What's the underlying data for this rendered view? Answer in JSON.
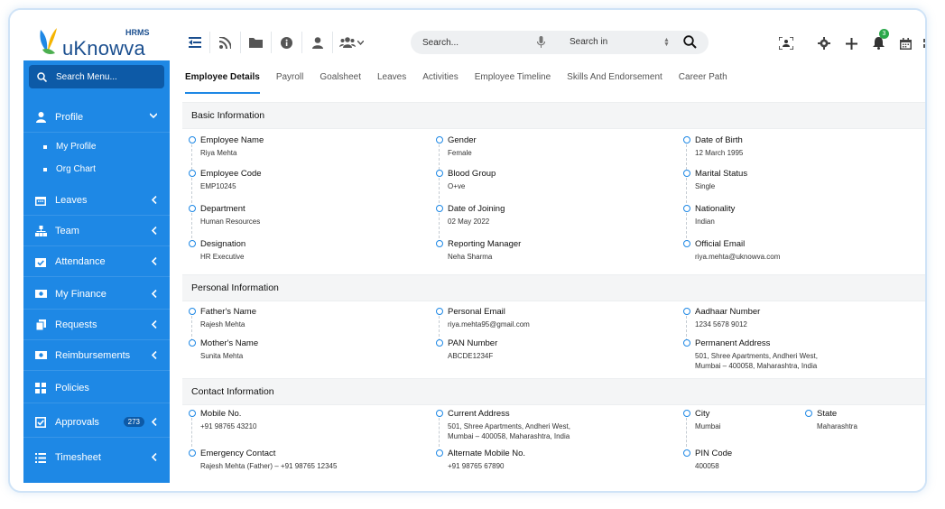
{
  "app": {
    "name": "uKnowva",
    "tag": "HRMS"
  },
  "search": {
    "placeholder": "Search...",
    "scope_label": "Search in"
  },
  "notifications": {
    "count": "3"
  },
  "sidebar": {
    "search_label": "Search Menu...",
    "items": [
      {
        "label": "Profile",
        "icon": "user-icon"
      },
      {
        "label": "Leaves",
        "icon": "calendar-icon"
      },
      {
        "label": "Team",
        "icon": "team-icon"
      },
      {
        "label": "Attendance",
        "icon": "attendance-icon"
      },
      {
        "label": "My Finance",
        "icon": "finance-icon"
      },
      {
        "label": "Requests",
        "icon": "requests-icon"
      },
      {
        "label": "Reimbursements",
        "icon": "reimbursement-icon"
      },
      {
        "label": "Policies",
        "icon": "policies-icon"
      },
      {
        "label": "Approvals",
        "icon": "approvals-icon",
        "count": "273"
      },
      {
        "label": "Timesheet",
        "icon": "timesheet-icon"
      }
    ],
    "profile_sub": [
      "My Profile",
      "Org Chart"
    ]
  },
  "tabs": [
    "Employee Details",
    "Payroll",
    "Goalsheet",
    "Leaves",
    "Activities",
    "Employee Timeline",
    "Skills And Endorsement",
    "Career Path"
  ],
  "sections": {
    "basic": {
      "title": "Basic Information",
      "fields": [
        {
          "label": "Employee Name",
          "value": "Riya Mehta"
        },
        {
          "label": "Gender",
          "value": "Female"
        },
        {
          "label": "Date of Birth",
          "value": "12 March 1995"
        },
        {
          "label": "Employee Code",
          "value": "EMP10245"
        },
        {
          "label": "Blood Group",
          "value": "O+ve"
        },
        {
          "label": "Marital Status",
          "value": "Single"
        },
        {
          "label": "Department",
          "value": "Human Resources"
        },
        {
          "label": "Date of Joining",
          "value": "02 May 2022"
        },
        {
          "label": "Nationality",
          "value": "Indian"
        },
        {
          "label": "Designation",
          "value": "HR Executive"
        },
        {
          "label": "Reporting Manager",
          "value": "Neha Sharma"
        },
        {
          "label": "Official Email",
          "value": "riya.mehta@uknowva.com"
        }
      ]
    },
    "personal": {
      "title": "Personal Information",
      "fields": [
        {
          "label": "Father's Name",
          "value": "Rajesh Mehta"
        },
        {
          "label": "Personal Email",
          "value": "riya.mehta95@gmail.com"
        },
        {
          "label": "Aadhaar Number",
          "value": "1234 5678 9012"
        },
        {
          "label": "Mother's Name",
          "value": "Sunita Mehta"
        },
        {
          "label": "PAN Number",
          "value": "ABCDE1234F"
        },
        {
          "label": "Permanent Address",
          "value": "501, Shree Apartments, Andheri West, Mumbai – 400058, Maharashtra, India"
        }
      ]
    },
    "contact": {
      "title": "Contact Information",
      "fields": [
        {
          "label": "Mobile No.",
          "value": "+91 98765 43210"
        },
        {
          "label": "Current Address",
          "value": "501, Shree Apartments, Andheri West, Mumbai – 400058, Maharashtra, India"
        },
        {
          "label": "City",
          "value": "Mumbai"
        },
        {
          "label": "State",
          "value": "Maharashtra"
        },
        {
          "label": "Emergency Contact",
          "value": "Rajesh Mehta (Father) – +91 98765 12345"
        },
        {
          "label": "Alternate Mobile No.",
          "value": "+91 98765 67890"
        },
        {
          "label": "PIN Code",
          "value": "400058"
        }
      ]
    }
  },
  "colors": {
    "accent": "#1e88e5",
    "sidebar_dark": "#0d5aa7",
    "badge_green": "#2aa84a"
  }
}
